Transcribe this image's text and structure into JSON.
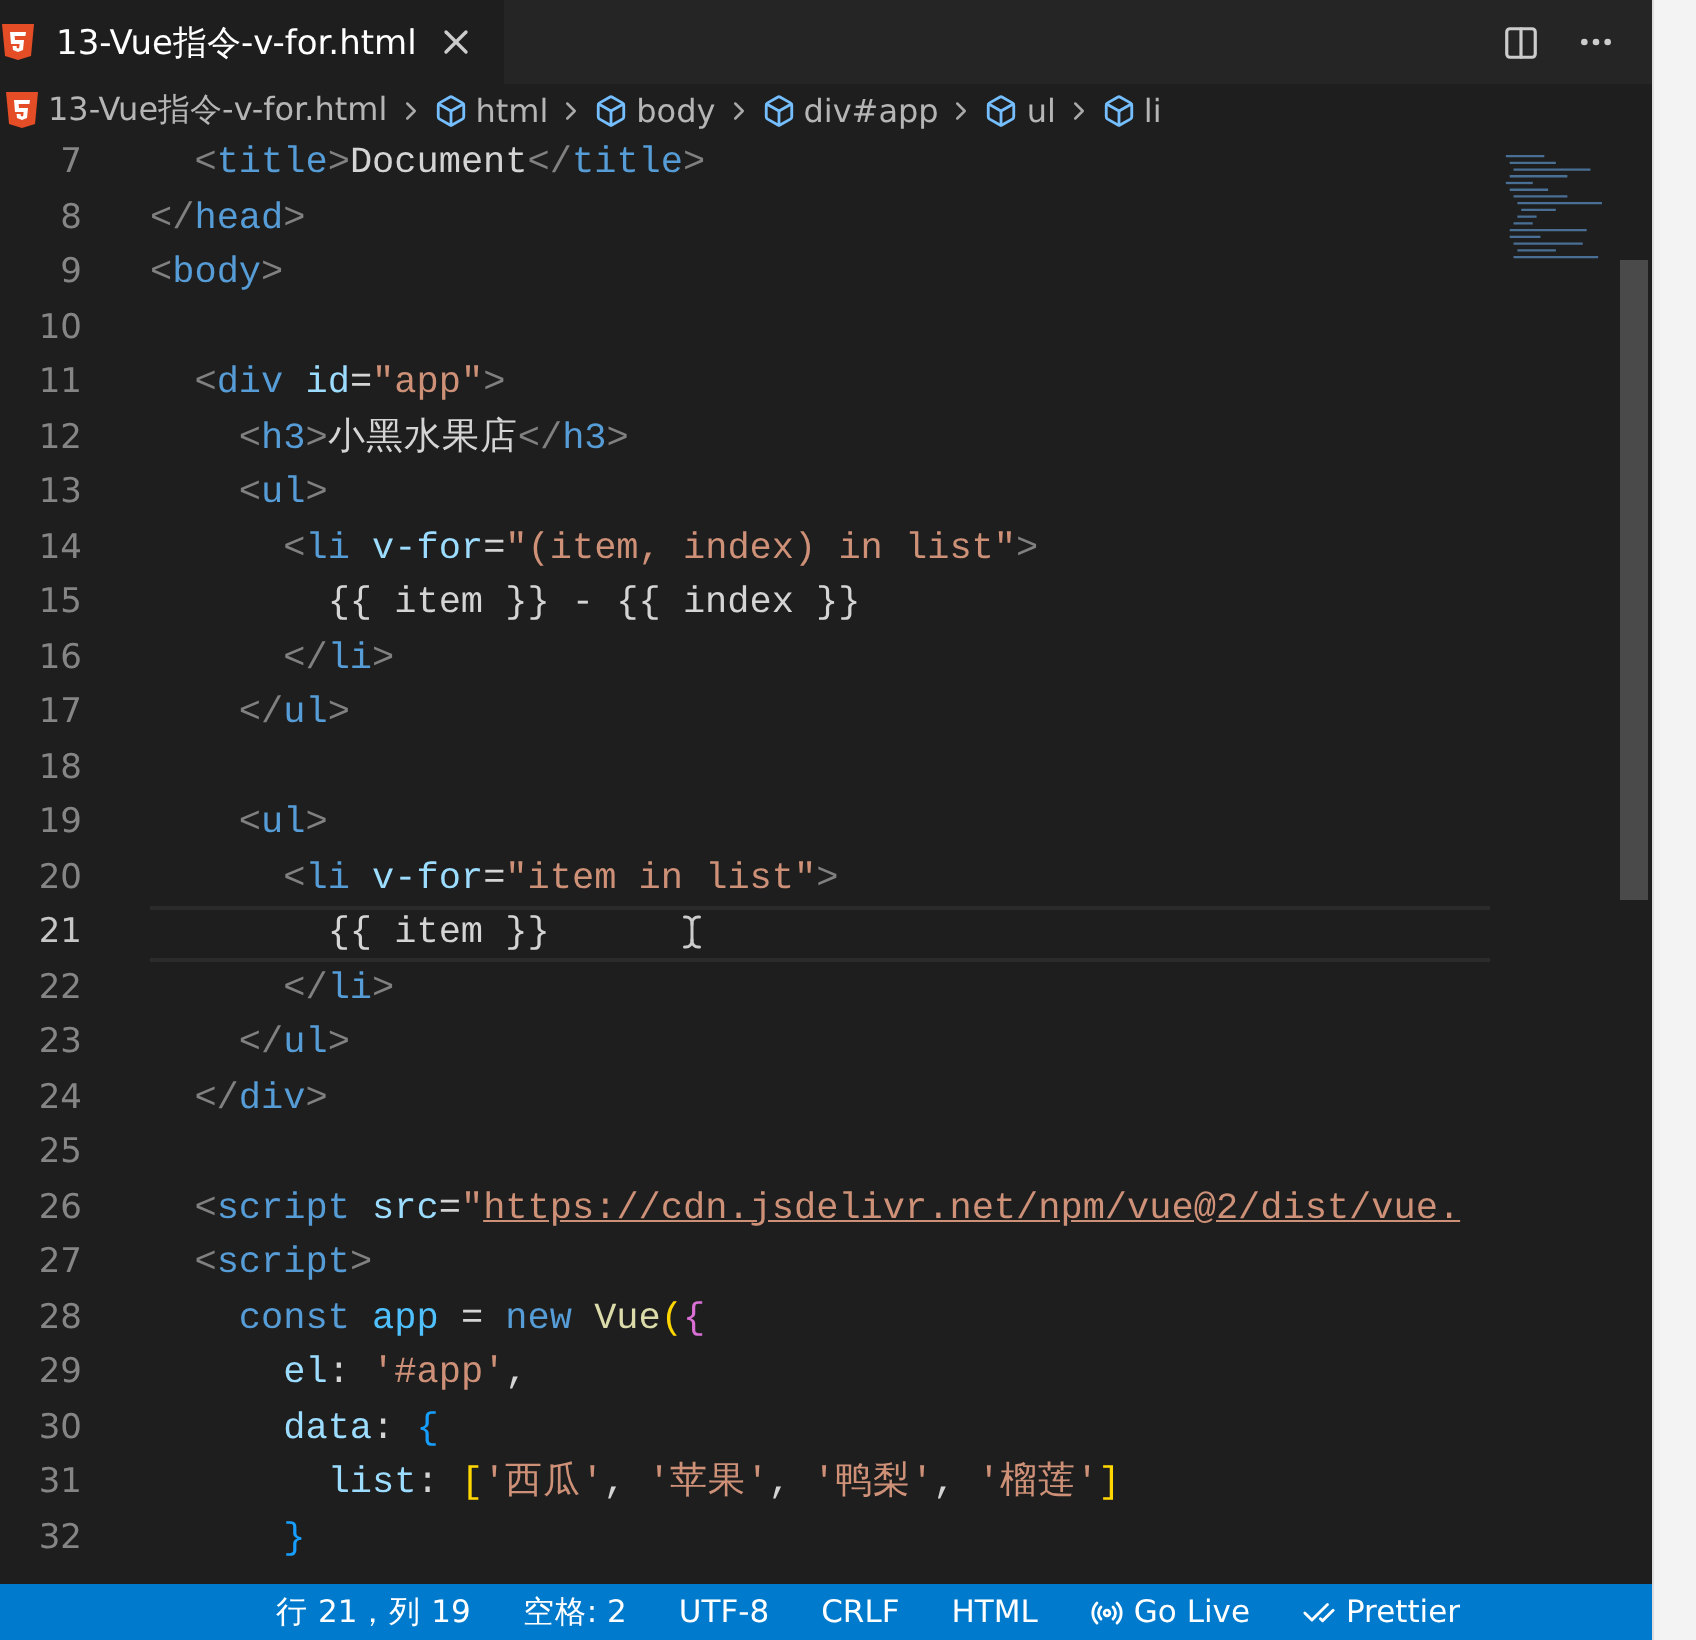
{
  "tab": {
    "label": "13-Vue指令-v-for.html",
    "selected": true
  },
  "breadcrumbs": [
    {
      "kind": "file",
      "label": "13-Vue指令-v-for.html"
    },
    {
      "kind": "element",
      "label": "html"
    },
    {
      "kind": "element",
      "label": "body"
    },
    {
      "kind": "element",
      "label": "div#app"
    },
    {
      "kind": "element",
      "label": "ul"
    },
    {
      "kind": "element",
      "label": "li"
    }
  ],
  "lines": [
    {
      "number": "7",
      "current": false,
      "tokens": [
        {
          "kind": "punct",
          "text": "  <"
        },
        {
          "kind": "tag",
          "text": "title"
        },
        {
          "kind": "punct",
          "text": ">"
        },
        {
          "kind": "plain",
          "text": "Document"
        },
        {
          "kind": "punct",
          "text": "</"
        },
        {
          "kind": "tag",
          "text": "title"
        },
        {
          "kind": "punct",
          "text": ">"
        }
      ]
    },
    {
      "number": "8",
      "current": false,
      "tokens": [
        {
          "kind": "punct",
          "text": "</"
        },
        {
          "kind": "tag",
          "text": "head"
        },
        {
          "kind": "punct",
          "text": ">"
        }
      ]
    },
    {
      "number": "9",
      "current": false,
      "tokens": [
        {
          "kind": "punct",
          "text": "<"
        },
        {
          "kind": "tag",
          "text": "body"
        },
        {
          "kind": "punct",
          "text": ">"
        }
      ]
    },
    {
      "number": "10",
      "current": false
    },
    {
      "number": "11",
      "current": false,
      "tokens": [
        {
          "kind": "punct",
          "text": "  <"
        },
        {
          "kind": "tag",
          "text": "div"
        },
        {
          "kind": "attr",
          "text": " id"
        },
        {
          "kind": "plain",
          "text": "="
        },
        {
          "kind": "string",
          "text": "\"app\""
        },
        {
          "kind": "punct",
          "text": ">"
        }
      ]
    },
    {
      "number": "12",
      "current": false,
      "tokens": [
        {
          "kind": "punct",
          "text": "    <"
        },
        {
          "kind": "tag",
          "text": "h3"
        },
        {
          "kind": "punct",
          "text": ">"
        },
        {
          "kind": "plain",
          "text": "小黑水果店"
        },
        {
          "kind": "punct",
          "text": "</"
        },
        {
          "kind": "tag",
          "text": "h3"
        },
        {
          "kind": "punct",
          "text": ">"
        }
      ]
    },
    {
      "number": "13",
      "current": false,
      "tokens": [
        {
          "kind": "punct",
          "text": "    <"
        },
        {
          "kind": "tag",
          "text": "ul"
        },
        {
          "kind": "punct",
          "text": ">"
        }
      ]
    },
    {
      "number": "14",
      "current": false,
      "tokens": [
        {
          "kind": "punct",
          "text": "      <"
        },
        {
          "kind": "tag",
          "text": "li"
        },
        {
          "kind": "attr",
          "text": " v-for"
        },
        {
          "kind": "plain",
          "text": "="
        },
        {
          "kind": "string",
          "text": "\"(item, index) in list\""
        },
        {
          "kind": "punct",
          "text": ">"
        }
      ]
    },
    {
      "number": "15",
      "current": false,
      "tokens": [
        {
          "kind": "plain",
          "text": "        {{ item }} - {{ index }}"
        }
      ]
    },
    {
      "number": "16",
      "current": false,
      "tokens": [
        {
          "kind": "punct",
          "text": "      </"
        },
        {
          "kind": "tag",
          "text": "li"
        },
        {
          "kind": "punct",
          "text": ">"
        }
      ]
    },
    {
      "number": "17",
      "current": false,
      "tokens": [
        {
          "kind": "punct",
          "text": "    </"
        },
        {
          "kind": "tag",
          "text": "ul"
        },
        {
          "kind": "punct",
          "text": ">"
        }
      ]
    },
    {
      "number": "18",
      "current": false
    },
    {
      "number": "19",
      "current": false,
      "tokens": [
        {
          "kind": "punct",
          "text": "    <"
        },
        {
          "kind": "tag",
          "text": "ul"
        },
        {
          "kind": "punct",
          "text": ">"
        }
      ]
    },
    {
      "number": "20",
      "current": false,
      "tokens": [
        {
          "kind": "punct",
          "text": "      <"
        },
        {
          "kind": "tag",
          "text": "li"
        },
        {
          "kind": "attr",
          "text": " v-for"
        },
        {
          "kind": "plain",
          "text": "="
        },
        {
          "kind": "string",
          "text": "\"item in list\""
        },
        {
          "kind": "punct",
          "text": ">"
        }
      ]
    },
    {
      "number": "21",
      "current": true,
      "tokens": [
        {
          "kind": "plain",
          "text": "        {{ item }}"
        }
      ]
    },
    {
      "number": "22",
      "current": false,
      "tokens": [
        {
          "kind": "punct",
          "text": "      </"
        },
        {
          "kind": "tag",
          "text": "li"
        },
        {
          "kind": "punct",
          "text": ">"
        }
      ]
    },
    {
      "number": "23",
      "current": false,
      "tokens": [
        {
          "kind": "punct",
          "text": "    </"
        },
        {
          "kind": "tag",
          "text": "ul"
        },
        {
          "kind": "punct",
          "text": ">"
        }
      ]
    },
    {
      "number": "24",
      "current": false,
      "tokens": [
        {
          "kind": "punct",
          "text": "  </"
        },
        {
          "kind": "tag",
          "text": "div"
        },
        {
          "kind": "punct",
          "text": ">"
        }
      ]
    },
    {
      "number": "25",
      "current": false
    },
    {
      "number": "26",
      "current": false,
      "tokens": [
        {
          "kind": "punct",
          "text": "  <"
        },
        {
          "kind": "tag",
          "text": "script"
        },
        {
          "kind": "attr",
          "text": " src"
        },
        {
          "kind": "plain",
          "text": "="
        },
        {
          "kind": "string",
          "text": "\""
        },
        {
          "kind": "link",
          "text": "https://cdn.jsdelivr.net/npm/vue@2/dist/vue."
        }
      ]
    },
    {
      "number": "27",
      "current": false,
      "tokens": [
        {
          "kind": "punct",
          "text": "  <"
        },
        {
          "kind": "tag",
          "text": "script"
        },
        {
          "kind": "punct",
          "text": ">"
        }
      ]
    },
    {
      "number": "28",
      "current": false,
      "tokens": [
        {
          "kind": "keyword",
          "text": "    const"
        },
        {
          "kind": "variable",
          "text": " app"
        },
        {
          "kind": "plain",
          "text": " = "
        },
        {
          "kind": "keyword",
          "text": "new"
        },
        {
          "kind": "class",
          "text": " Vue"
        },
        {
          "kind": "bracket1",
          "text": "("
        },
        {
          "kind": "bracket2",
          "text": "{"
        }
      ]
    },
    {
      "number": "29",
      "current": false,
      "tokens": [
        {
          "kind": "property",
          "text": "      el"
        },
        {
          "kind": "plain",
          "text": ": "
        },
        {
          "kind": "string",
          "text": "'#app'"
        },
        {
          "kind": "plain",
          "text": ","
        }
      ]
    },
    {
      "number": "30",
      "current": false,
      "tokens": [
        {
          "kind": "property",
          "text": "      data"
        },
        {
          "kind": "plain",
          "text": ": "
        },
        {
          "kind": "bracket3",
          "text": "{"
        }
      ]
    },
    {
      "number": "31",
      "current": false,
      "tokens": [
        {
          "kind": "property",
          "text": "        list"
        },
        {
          "kind": "plain",
          "text": ": "
        },
        {
          "kind": "bracket1",
          "text": "["
        },
        {
          "kind": "string",
          "text": "'西瓜'"
        },
        {
          "kind": "plain",
          "text": ", "
        },
        {
          "kind": "string",
          "text": "'苹果'"
        },
        {
          "kind": "plain",
          "text": ", "
        },
        {
          "kind": "string",
          "text": "'鸭梨'"
        },
        {
          "kind": "plain",
          "text": ", "
        },
        {
          "kind": "string",
          "text": "'榴莲'"
        },
        {
          "kind": "bracket1",
          "text": "]"
        }
      ]
    },
    {
      "number": "32",
      "current": false,
      "tokens": [
        {
          "kind": "bracket3",
          "text": "      }"
        }
      ]
    }
  ],
  "status": [
    {
      "kind": "text",
      "label": "行 21，列 19"
    },
    {
      "kind": "text",
      "label": "空格: 2"
    },
    {
      "kind": "text",
      "label": "UTF-8"
    },
    {
      "kind": "text",
      "label": "CRLF"
    },
    {
      "kind": "text",
      "label": "HTML"
    },
    {
      "kind": "live",
      "label": "Go Live"
    },
    {
      "kind": "prettier",
      "label": "Prettier"
    }
  ]
}
